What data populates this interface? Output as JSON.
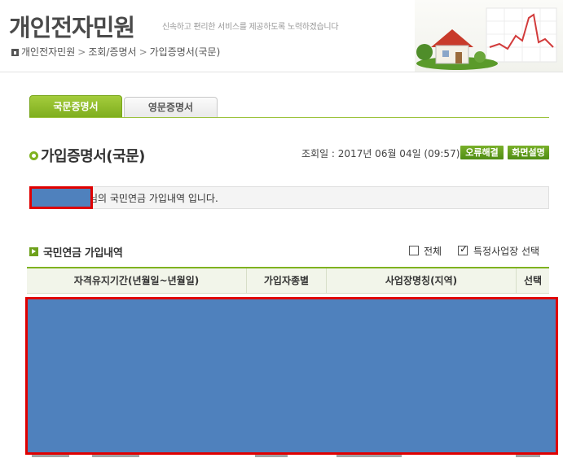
{
  "header": {
    "site_title": "개인전자민원",
    "slogan": "신속하고 편리한 서비스를 제공하도록 노력하겠습니다",
    "breadcrumb": [
      "개인전자민원",
      "조회/증명서",
      "가입증명서(국문)"
    ],
    "breadcrumb_separator": ">"
  },
  "tabs": [
    {
      "label": "국문증명서",
      "active": true
    },
    {
      "label": "영문증명서",
      "active": false
    }
  ],
  "page": {
    "title": "가입증명서(국문)",
    "inquiry_date": "조회일 : 2017년 06월 04일 (09:57)",
    "error_button": "오류해결",
    "help_button": "화면설명"
  },
  "message": {
    "text": "님의 국민연금 가입내역 입니다."
  },
  "section": {
    "title": "국민연금 가입내역",
    "checkbox_all_label": "전체",
    "checkbox_all_checked": false,
    "checkbox_specific_label": "특정사업장 선택",
    "checkbox_specific_checked": true
  },
  "table": {
    "columns": [
      "자격유지기간(년월일~년월일)",
      "가입자종별",
      "사업장명칭(지역)",
      "선택"
    ]
  },
  "colors": {
    "accent_green": "#7fb21f",
    "redaction_fill": "#4f81bd",
    "redaction_border": "#e00000"
  }
}
